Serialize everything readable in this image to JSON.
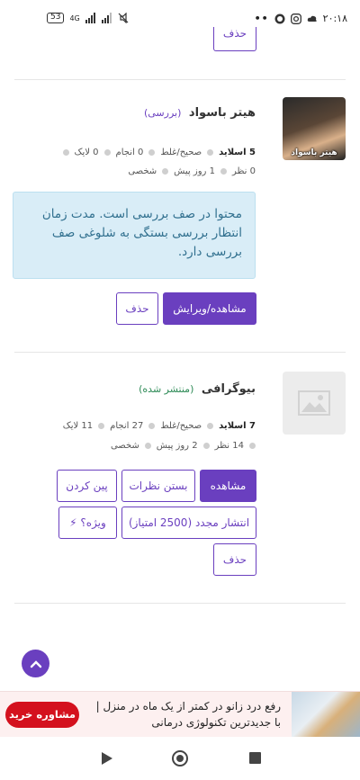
{
  "status_bar": {
    "time": "۲۰:۱۸",
    "battery": "53",
    "network": "4G"
  },
  "top_partial": {
    "delete_label": "حذف"
  },
  "posts": [
    {
      "title": "هیتر باسواد",
      "status": "(بررسی)",
      "thumb_caption": "هیتر باسواد",
      "slides": "5 اسلاید",
      "correct_wrong": "صحیح/غلط",
      "done": "0 انجام",
      "likes": "0 لایک",
      "comments": "0 نظر",
      "time_ago": "1 روز پیش",
      "visibility": "شخصی",
      "notice": "محتوا در صف بررسی است. مدت زمان انتظار بررسی بستگی به شلوغی صف بررسی دارد.",
      "buttons": {
        "view_edit": "مشاهده/ویرایش",
        "delete": "حذف"
      }
    },
    {
      "title": "بیوگرافی",
      "status": "(منتشر شده)",
      "slides": "7 اسلاید",
      "correct_wrong": "صحیح/غلط",
      "done": "27 انجام",
      "likes": "11 لایک",
      "comments": "14 نظر",
      "time_ago": "2 روز پیش",
      "visibility": "شخصی",
      "buttons": {
        "view": "مشاهده",
        "close_comments": "بستن نظرات",
        "pin": "پین کردن",
        "republish": "انتشار مجدد (2500 امتیاز)",
        "special": "⚡ ویژه؟",
        "delete": "حذف"
      }
    }
  ],
  "ad": {
    "text": "رفع درد زانو در کمتر از یک ماه در منزل | با جدیدترین تکنولوژی درمانی",
    "button": "مشاوره خرید"
  },
  "colors": {
    "accent": "#6a3fbf",
    "published": "#2e8b57",
    "notice_bg": "#d9edf7",
    "ad_button": "#d4111e"
  }
}
